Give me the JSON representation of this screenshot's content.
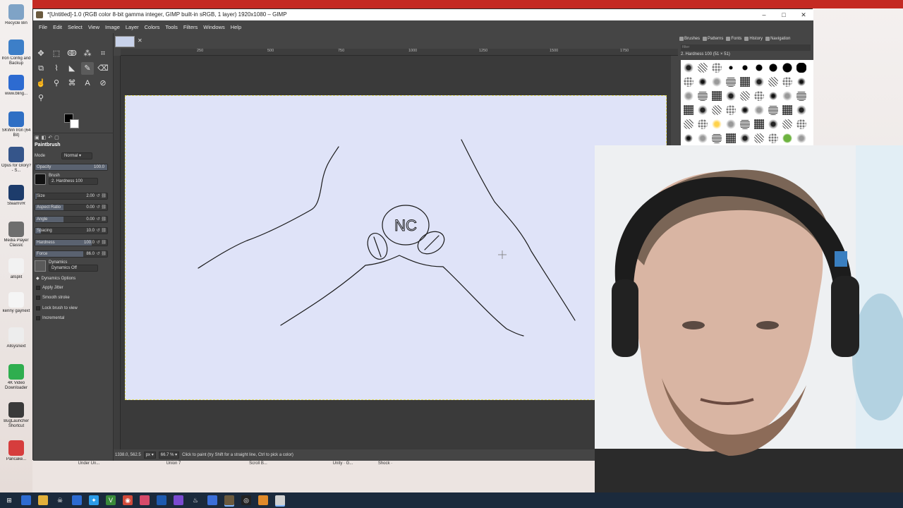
{
  "desktop": {
    "icons": [
      {
        "label": "Recycle Bin",
        "color": "#7fa3c6"
      },
      {
        "label": "Iron Config and Backup",
        "color": "#3d7fc8"
      },
      {
        "label": "www.bling...",
        "color": "#2d6bd1"
      },
      {
        "label": "SKWin Iron (64 Bit)",
        "color": "#2f6fc4"
      },
      {
        "label": "Opus for Glory? - S...",
        "color": "#35558a"
      },
      {
        "label": "SteamVR",
        "color": "#1d3c6b"
      },
      {
        "label": "Media Player Classic",
        "color": "#6e6e6e"
      },
      {
        "label": "allsplit",
        "color": "#f2f2f2"
      },
      {
        "label": "kenny gaynext",
        "color": "#f5f5f5"
      },
      {
        "label": "Allsysnext",
        "color": "#ededed"
      },
      {
        "label": "4K Video Downloader",
        "color": "#2fae4f"
      },
      {
        "label": "BugLauncher Shortcut",
        "color": "#3a3a3a"
      },
      {
        "label": "Pancake...",
        "color": "#d63d3d"
      }
    ],
    "bottom_labels": [
      "Under Un...",
      "",
      "Union 7",
      "",
      "Scroll B...",
      "",
      "Unity · G...",
      "Shock ·",
      "",
      ""
    ]
  },
  "gimp": {
    "title": "*[Untitled]-1.0 (RGB color 8-bit gamma integer, GIMP built-in sRGB, 1 layer) 1920x1080 – GIMP",
    "window_controls": [
      "–",
      "□",
      "✕"
    ],
    "menu": [
      "File",
      "Edit",
      "Select",
      "View",
      "Image",
      "Layer",
      "Colors",
      "Tools",
      "Filters",
      "Windows",
      "Help"
    ],
    "tool_icons": [
      {
        "name": "move-tool-icon",
        "glyph": "✥"
      },
      {
        "name": "rect-select-icon",
        "glyph": "⬚"
      },
      {
        "name": "lasso-icon",
        "glyph": "ↂ"
      },
      {
        "name": "fuzzy-select-icon",
        "glyph": "⁂"
      },
      {
        "name": "crop-icon",
        "glyph": "⌗"
      },
      {
        "name": "unified-transform-icon",
        "glyph": "⧉"
      },
      {
        "name": "warp-icon",
        "glyph": "⌇"
      },
      {
        "name": "bucket-fill-icon",
        "glyph": "◣"
      },
      {
        "name": "paintbrush-icon",
        "glyph": "✎"
      },
      {
        "name": "eraser-icon",
        "glyph": "⌫"
      },
      {
        "name": "smudge-icon",
        "glyph": "☝"
      },
      {
        "name": "dodge-icon",
        "glyph": "⚲"
      },
      {
        "name": "paths-icon",
        "glyph": "⌘"
      },
      {
        "name": "text-tool-icon",
        "glyph": "A"
      },
      {
        "name": "color-picker-icon",
        "glyph": "⊘"
      },
      {
        "name": "zoom-icon",
        "glyph": "⚲"
      }
    ],
    "tool_options": {
      "title": "Paintbrush",
      "mode_label": "Mode",
      "mode_value": "Normal",
      "opacity_label": "Opacity",
      "opacity_value": "100.0",
      "brush_label": "Brush",
      "brush_value": "2. Hardness 100",
      "sliders": [
        {
          "label": "Size",
          "value": "2.00",
          "fraction": 0.02
        },
        {
          "label": "Aspect Ratio",
          "value": "0.00",
          "fraction": 0.5
        },
        {
          "label": "Angle",
          "value": "0.00",
          "fraction": 0.5
        },
        {
          "label": "Spacing",
          "value": "10.0",
          "fraction": 0.1
        },
        {
          "label": "Hardness",
          "value": "100.0",
          "fraction": 1.0
        },
        {
          "label": "Force",
          "value": "86.0",
          "fraction": 0.86
        }
      ],
      "dynamics_label": "Dynamics",
      "dynamics_value": "Dynamics Off",
      "dynamics_options": "Dynamics Options",
      "checks": [
        "Apply Jitter",
        "Smooth stroke",
        "Lock brush to view",
        "Incremental"
      ]
    },
    "ruler": [
      "250",
      "500",
      "750",
      "1000",
      "1250",
      "1500",
      "1750"
    ],
    "status": {
      "coords": "1338.0, 562.5",
      "unit": "px",
      "zoom": "66.7 %",
      "message": "Click to paint (try Shift for a straight line, Ctrl to pick a color)"
    },
    "dock": {
      "tabs": [
        "Brushes",
        "Patterns",
        "Fonts",
        "History",
        "Navigation"
      ],
      "filter_placeholder": "filter",
      "brush_name": "2. Hardness 100 (51 × 51)"
    },
    "canvas_text": "NC"
  },
  "colors": {
    "gimp_bg": "#454545",
    "canvas": "#dfe3f8",
    "taskbar": "#1b2a3c",
    "red_strip": "#c42a23"
  }
}
